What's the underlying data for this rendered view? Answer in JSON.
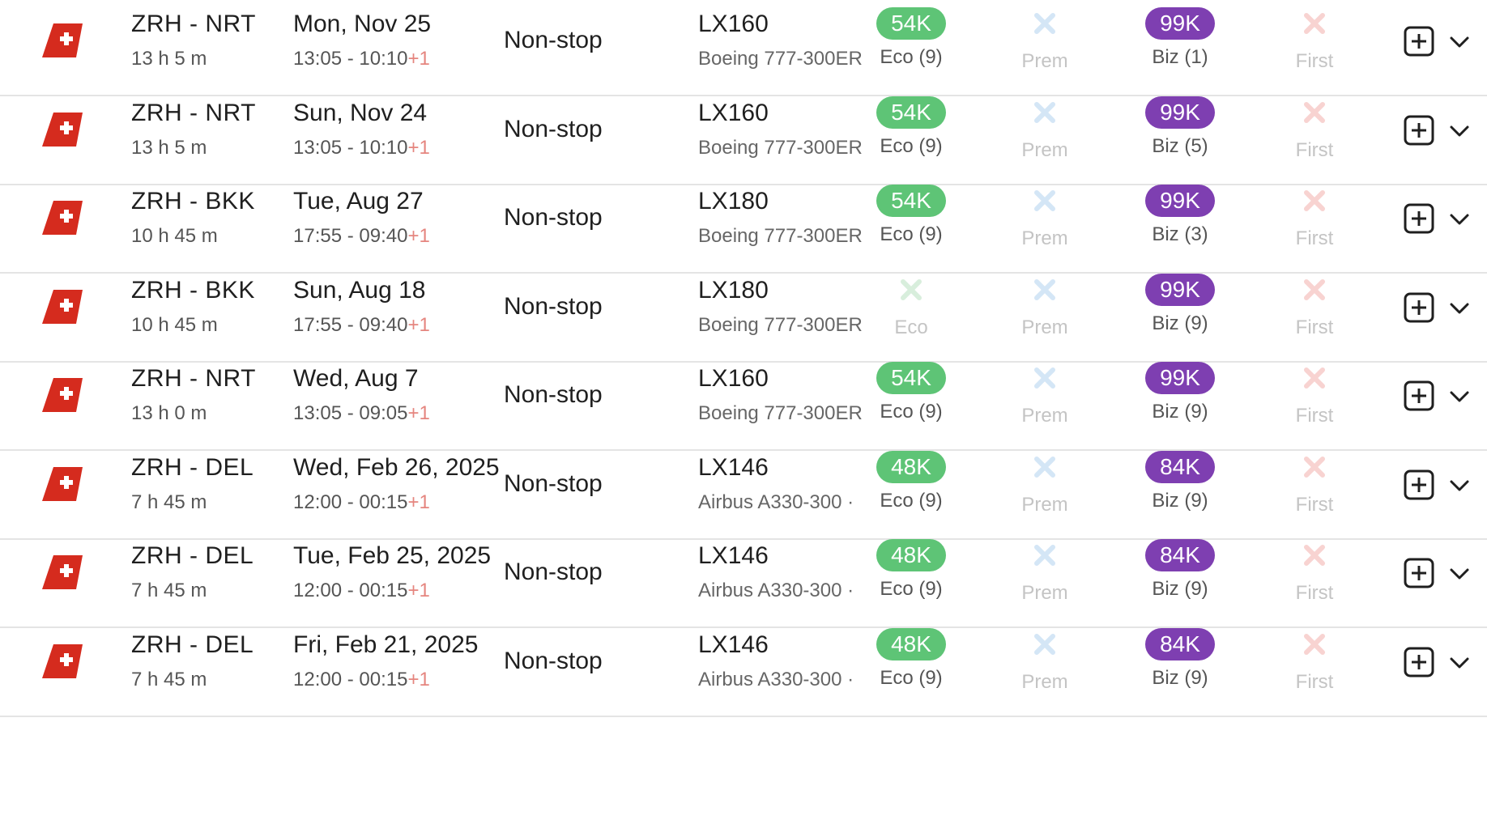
{
  "colors": {
    "eco_pill": "#5ec476",
    "biz_pill": "#7e3fb1",
    "prem_unavailable": "#d4e6f6",
    "first_unavailable": "#f8d3d1",
    "eco_unavailable": "#d8eedc",
    "plus_day": "#e5857f",
    "swiss_red": "#d52b1e"
  },
  "icons": {
    "airline_logo": "swiss-logo-icon",
    "unavailable": "x-icon",
    "add": "plus-square-icon",
    "expand": "chevron-down-icon"
  },
  "flights": [
    {
      "route": "ZRH - NRT",
      "duration": "13 h 5 m",
      "date": "Mon, Nov 25",
      "times": "13:05 - 10:10",
      "plus_day": "+1",
      "stops": "Non-stop",
      "flight_no": "LX160",
      "aircraft": "Boeing 777-300ER",
      "eco": {
        "available": true,
        "points": "54K",
        "label": "Eco (9)"
      },
      "prem": {
        "available": false,
        "label": "Prem"
      },
      "biz": {
        "available": true,
        "points": "99K",
        "label": "Biz (1)"
      },
      "first": {
        "available": false,
        "label": "First"
      }
    },
    {
      "route": "ZRH - NRT",
      "duration": "13 h 5 m",
      "date": "Sun, Nov 24",
      "times": "13:05 - 10:10",
      "plus_day": "+1",
      "stops": "Non-stop",
      "flight_no": "LX160",
      "aircraft": "Boeing 777-300ER",
      "eco": {
        "available": true,
        "points": "54K",
        "label": "Eco (9)"
      },
      "prem": {
        "available": false,
        "label": "Prem"
      },
      "biz": {
        "available": true,
        "points": "99K",
        "label": "Biz (5)"
      },
      "first": {
        "available": false,
        "label": "First"
      }
    },
    {
      "route": "ZRH - BKK",
      "duration": "10 h 45 m",
      "date": "Tue, Aug 27",
      "times": "17:55 - 09:40",
      "plus_day": "+1",
      "stops": "Non-stop",
      "flight_no": "LX180",
      "aircraft": "Boeing 777-300ER",
      "eco": {
        "available": true,
        "points": "54K",
        "label": "Eco (9)"
      },
      "prem": {
        "available": false,
        "label": "Prem"
      },
      "biz": {
        "available": true,
        "points": "99K",
        "label": "Biz (3)"
      },
      "first": {
        "available": false,
        "label": "First"
      }
    },
    {
      "route": "ZRH - BKK",
      "duration": "10 h 45 m",
      "date": "Sun, Aug 18",
      "times": "17:55 - 09:40",
      "plus_day": "+1",
      "stops": "Non-stop",
      "flight_no": "LX180",
      "aircraft": "Boeing 777-300ER",
      "eco": {
        "available": false,
        "label": "Eco"
      },
      "prem": {
        "available": false,
        "label": "Prem"
      },
      "biz": {
        "available": true,
        "points": "99K",
        "label": "Biz (9)"
      },
      "first": {
        "available": false,
        "label": "First"
      }
    },
    {
      "route": "ZRH - NRT",
      "duration": "13 h 0 m",
      "date": "Wed, Aug 7",
      "times": "13:05 - 09:05",
      "plus_day": "+1",
      "stops": "Non-stop",
      "flight_no": "LX160",
      "aircraft": "Boeing 777-300ER",
      "eco": {
        "available": true,
        "points": "54K",
        "label": "Eco (9)"
      },
      "prem": {
        "available": false,
        "label": "Prem"
      },
      "biz": {
        "available": true,
        "points": "99K",
        "label": "Biz (9)"
      },
      "first": {
        "available": false,
        "label": "First"
      }
    },
    {
      "route": "ZRH - DEL",
      "duration": "7 h 45 m",
      "date": "Wed, Feb 26, 2025",
      "times": "12:00 - 00:15",
      "plus_day": "+1",
      "stops": "Non-stop",
      "flight_no": "LX146",
      "aircraft": "Airbus A330-300 ·",
      "eco": {
        "available": true,
        "points": "48K",
        "label": "Eco (9)"
      },
      "prem": {
        "available": false,
        "label": "Prem"
      },
      "biz": {
        "available": true,
        "points": "84K",
        "label": "Biz (9)"
      },
      "first": {
        "available": false,
        "label": "First"
      }
    },
    {
      "route": "ZRH - DEL",
      "duration": "7 h 45 m",
      "date": "Tue, Feb 25, 2025",
      "times": "12:00 - 00:15",
      "plus_day": "+1",
      "stops": "Non-stop",
      "flight_no": "LX146",
      "aircraft": "Airbus A330-300 ·",
      "eco": {
        "available": true,
        "points": "48K",
        "label": "Eco (9)"
      },
      "prem": {
        "available": false,
        "label": "Prem"
      },
      "biz": {
        "available": true,
        "points": "84K",
        "label": "Biz (9)"
      },
      "first": {
        "available": false,
        "label": "First"
      }
    },
    {
      "route": "ZRH - DEL",
      "duration": "7 h 45 m",
      "date": "Fri, Feb 21, 2025",
      "times": "12:00 - 00:15",
      "plus_day": "+1",
      "stops": "Non-stop",
      "flight_no": "LX146",
      "aircraft": "Airbus A330-300 ·",
      "eco": {
        "available": true,
        "points": "48K",
        "label": "Eco (9)"
      },
      "prem": {
        "available": false,
        "label": "Prem"
      },
      "biz": {
        "available": true,
        "points": "84K",
        "label": "Biz (9)"
      },
      "first": {
        "available": false,
        "label": "First"
      }
    }
  ]
}
